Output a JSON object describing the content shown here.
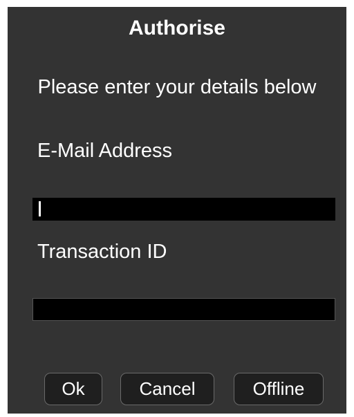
{
  "dialog": {
    "title": "Authorise",
    "subtitle": "Please enter your details below",
    "email": {
      "label": "E-Mail Address",
      "value": "",
      "placeholder": ""
    },
    "transaction": {
      "label": "Transaction ID",
      "value": "",
      "placeholder": ""
    },
    "buttons": {
      "ok": "Ok",
      "cancel": "Cancel",
      "offline": "Offline"
    }
  },
  "colors": {
    "dialog_background": "#333333",
    "field_background": "#000000",
    "button_background": "#1f1f1f",
    "text": "#ffffff"
  }
}
